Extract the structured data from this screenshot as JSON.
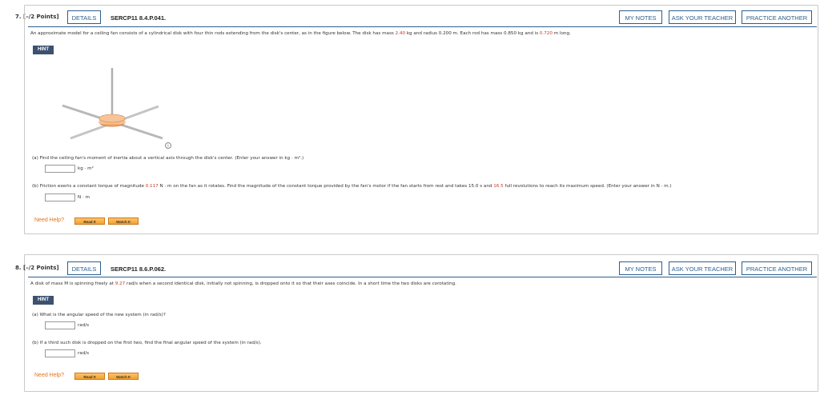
{
  "problem7": {
    "number": "7. [–/2 Points]",
    "details": "DETAILS",
    "code": "SERCP11 8.4.P.041.",
    "my_notes": "MY NOTES",
    "ask_teacher": "ASK YOUR TEACHER",
    "practice": "PRACTICE ANOTHER",
    "statement_1": "An approximate model for a ceiling fan consists of a cylindrical disk with four thin rods extending from the disk's center, as in the figure below. The disk has mass",
    "mass": "2.40",
    "statement_2": "kg and radius 0.200 m. Each rod has mass 0.850 kg and is",
    "length": "0.720",
    "statement_3": "m long.",
    "hint": "HINT",
    "part_a": "(a)   Find the ceiling fan's moment of inertia about a vertical axis through the disk's center. (Enter your answer in kg · m².)",
    "unit_a": "kg · m²",
    "part_b_1": "(b)   Friction exerts a constant torque of magnitude",
    "torque": "0.117",
    "part_b_2": "N · m on the fan as it rotates. Find the magnitude of the constant torque provided by the fan's motor if the fan starts from rest and takes 15.0 s and",
    "revs": "16.5",
    "part_b_3": "full revolutions to reach its maximum speed. (Enter your answer in N · m.)",
    "unit_b": "N · m",
    "need_help": "Need Help?",
    "read_it": "Read It",
    "watch_it": "Watch It"
  },
  "problem8": {
    "number": "8. [–/2 Points]",
    "details": "DETAILS",
    "code": "SERCP11 8.6.P.062.",
    "my_notes": "MY NOTES",
    "ask_teacher": "ASK YOUR TEACHER",
    "practice": "PRACTICE ANOTHER",
    "statement_1": "A disk of mass M is spinning freely at",
    "speed": "9.27",
    "statement_2": "rad/s when a second identical disk, initially not spinning, is dropped onto it so that their axes coincide. In a short time the two disks are corotating.",
    "hint": "HINT",
    "part_a": "(a)   What is the angular speed of the new system (in rad/s)?",
    "unit_a": "rad/s",
    "part_b": "(b)   If a third such disk is dropped on the first two, find the final angular speed of the system (in rad/s).",
    "unit_b": "rad/s",
    "need_help": "Need Help?",
    "read_it": "Read It",
    "watch_it": "Watch It"
  },
  "colors": {
    "accent": "#2c5f8d",
    "value_red": "#c0392b",
    "need_help": "#e0751a",
    "hint_bg": "#3d5170"
  },
  "icons": {
    "info": "info-icon"
  }
}
